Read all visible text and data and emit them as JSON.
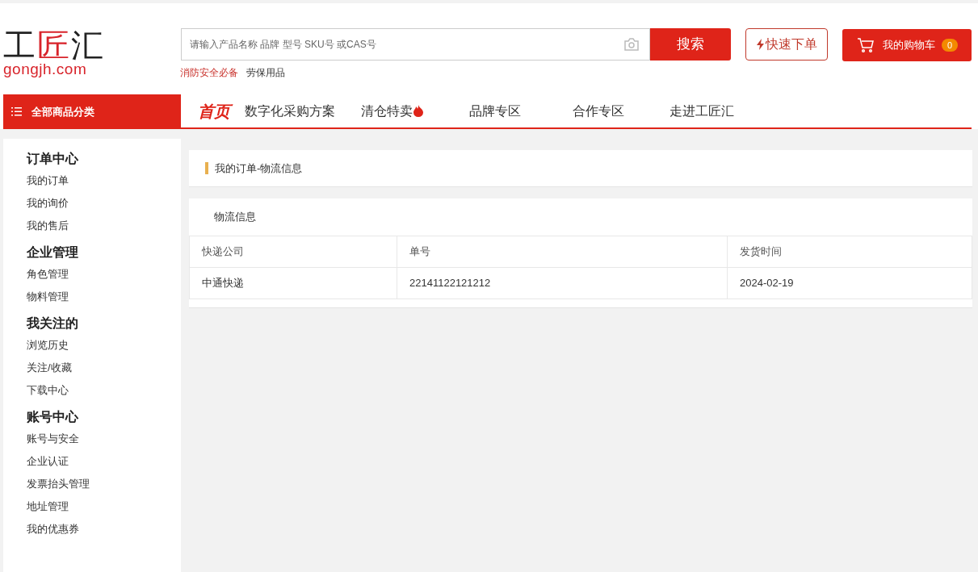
{
  "logo": {
    "chars": [
      {
        "text": "工",
        "accent": false
      },
      {
        "text": "匠",
        "accent": true
      },
      {
        "text": "汇",
        "accent": false
      }
    ],
    "domain": "gongjh.com"
  },
  "search": {
    "placeholder": "请输入产品名称 品牌 型号 SKU号 或CAS号",
    "button": "搜索"
  },
  "hot_links": [
    {
      "label": "消防安全必备",
      "highlight": true
    },
    {
      "label": "劳保用品",
      "highlight": false
    }
  ],
  "quick_order": "快速下单",
  "cart": {
    "label": "我的购物车",
    "count": "0"
  },
  "category_button": "全部商品分类",
  "nav": [
    {
      "label": "首页",
      "selected": true,
      "hot": false
    },
    {
      "label": "数字化采购方案",
      "selected": false,
      "hot": false
    },
    {
      "label": "清仓特卖",
      "selected": false,
      "hot": true
    },
    {
      "label": "品牌专区",
      "selected": false,
      "hot": false
    },
    {
      "label": "合作专区",
      "selected": false,
      "hot": false
    },
    {
      "label": "走进工匠汇",
      "selected": false,
      "hot": false
    }
  ],
  "sidebar": [
    {
      "title": "订单中心",
      "items": [
        "我的订单",
        "我的询价",
        "我的售后"
      ]
    },
    {
      "title": "企业管理",
      "items": [
        "角色管理",
        "物料管理"
      ]
    },
    {
      "title": "我关注的",
      "items": [
        "浏览历史",
        "关注/收藏",
        "下载中心"
      ]
    },
    {
      "title": "账号中心",
      "items": [
        "账号与安全",
        "企业认证",
        "发票抬头管理",
        "地址管理",
        "我的优惠券"
      ]
    }
  ],
  "breadcrumb": "我的订单-物流信息",
  "logistics": {
    "title": "物流信息",
    "columns": [
      "快递公司",
      "单号",
      "发货时间"
    ],
    "rows": [
      [
        "中通快递",
        "22141122121212",
        "2024-02-19"
      ]
    ]
  }
}
